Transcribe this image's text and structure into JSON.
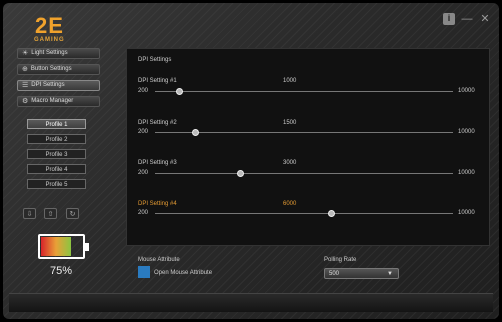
{
  "brand": {
    "logo_big": "2E",
    "logo_small": "GAMING"
  },
  "window_icons": {
    "info": "i",
    "minimize": "—",
    "close": "✕"
  },
  "nav": [
    {
      "label": "Light Settings",
      "icon": "sun-icon"
    },
    {
      "label": "Button Settings",
      "icon": "target-icon"
    },
    {
      "label": "DPI Settings",
      "icon": "sliders-icon"
    },
    {
      "label": "Macro Manager",
      "icon": "gear-icon"
    }
  ],
  "profiles": [
    "Profile 1",
    "Profile 2",
    "Profile 3",
    "Profile 4",
    "Profile 5"
  ],
  "small_buttons": [
    "import-icon",
    "export-icon",
    "reset-icon"
  ],
  "battery": {
    "percent_label": "75%",
    "level": 0.75
  },
  "dpi": {
    "title": "DPI Settings",
    "min": "200",
    "max": "10000",
    "settings": [
      {
        "label": "DPI Setting #1",
        "value": "1000",
        "active": false
      },
      {
        "label": "DPI Setting #2",
        "value": "1500",
        "active": false
      },
      {
        "label": "DPI Setting #3",
        "value": "3000",
        "active": false
      },
      {
        "label": "DPI Setting #4",
        "value": "6000",
        "active": true
      }
    ]
  },
  "mouse_attribute": {
    "title": "Mouse Attribute",
    "checkbox_label": "Open Mouse Attribute",
    "checked": true
  },
  "polling": {
    "title": "Polling Rate",
    "value": "500"
  },
  "colors": {
    "accent": "#e39a33",
    "checkbox": "#2a7bc0"
  }
}
